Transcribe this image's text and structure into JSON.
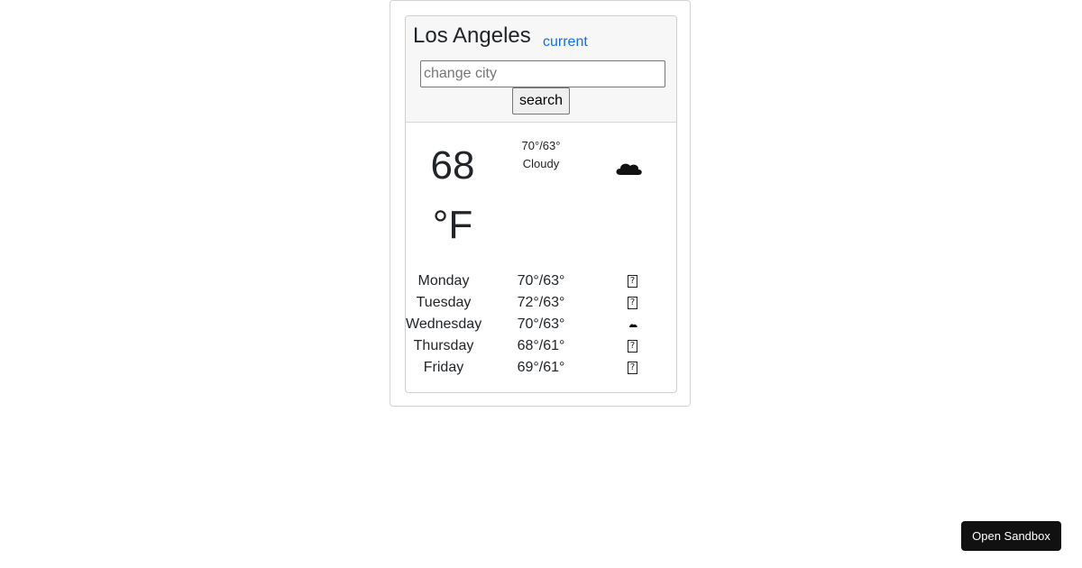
{
  "header": {
    "city": "Los Angeles",
    "current_link": "current",
    "input_placeholder": "change city",
    "input_value": "",
    "search_label": "search"
  },
  "today": {
    "temperature": "68",
    "unit": "°F",
    "high_low": "70°/63°",
    "condition": "Cloudy",
    "icon": "cloud-icon"
  },
  "forecast": [
    {
      "day": "Monday",
      "temps": "70°/63°",
      "icon": "missing-glyph-icon"
    },
    {
      "day": "Tuesday",
      "temps": "72°/63°",
      "icon": "missing-glyph-icon"
    },
    {
      "day": "Wednesday",
      "temps": "70°/63°",
      "icon": "cloud-icon"
    },
    {
      "day": "Thursday",
      "temps": "68°/61°",
      "icon": "missing-glyph-icon"
    },
    {
      "day": "Friday",
      "temps": "69°/61°",
      "icon": "missing-glyph-icon"
    }
  ],
  "footer": {
    "sandbox_label": "Open Sandbox"
  },
  "colors": {
    "link": "#0d6efd",
    "header_bg": "#f7f7f7",
    "sandbox_bg": "#111111"
  }
}
